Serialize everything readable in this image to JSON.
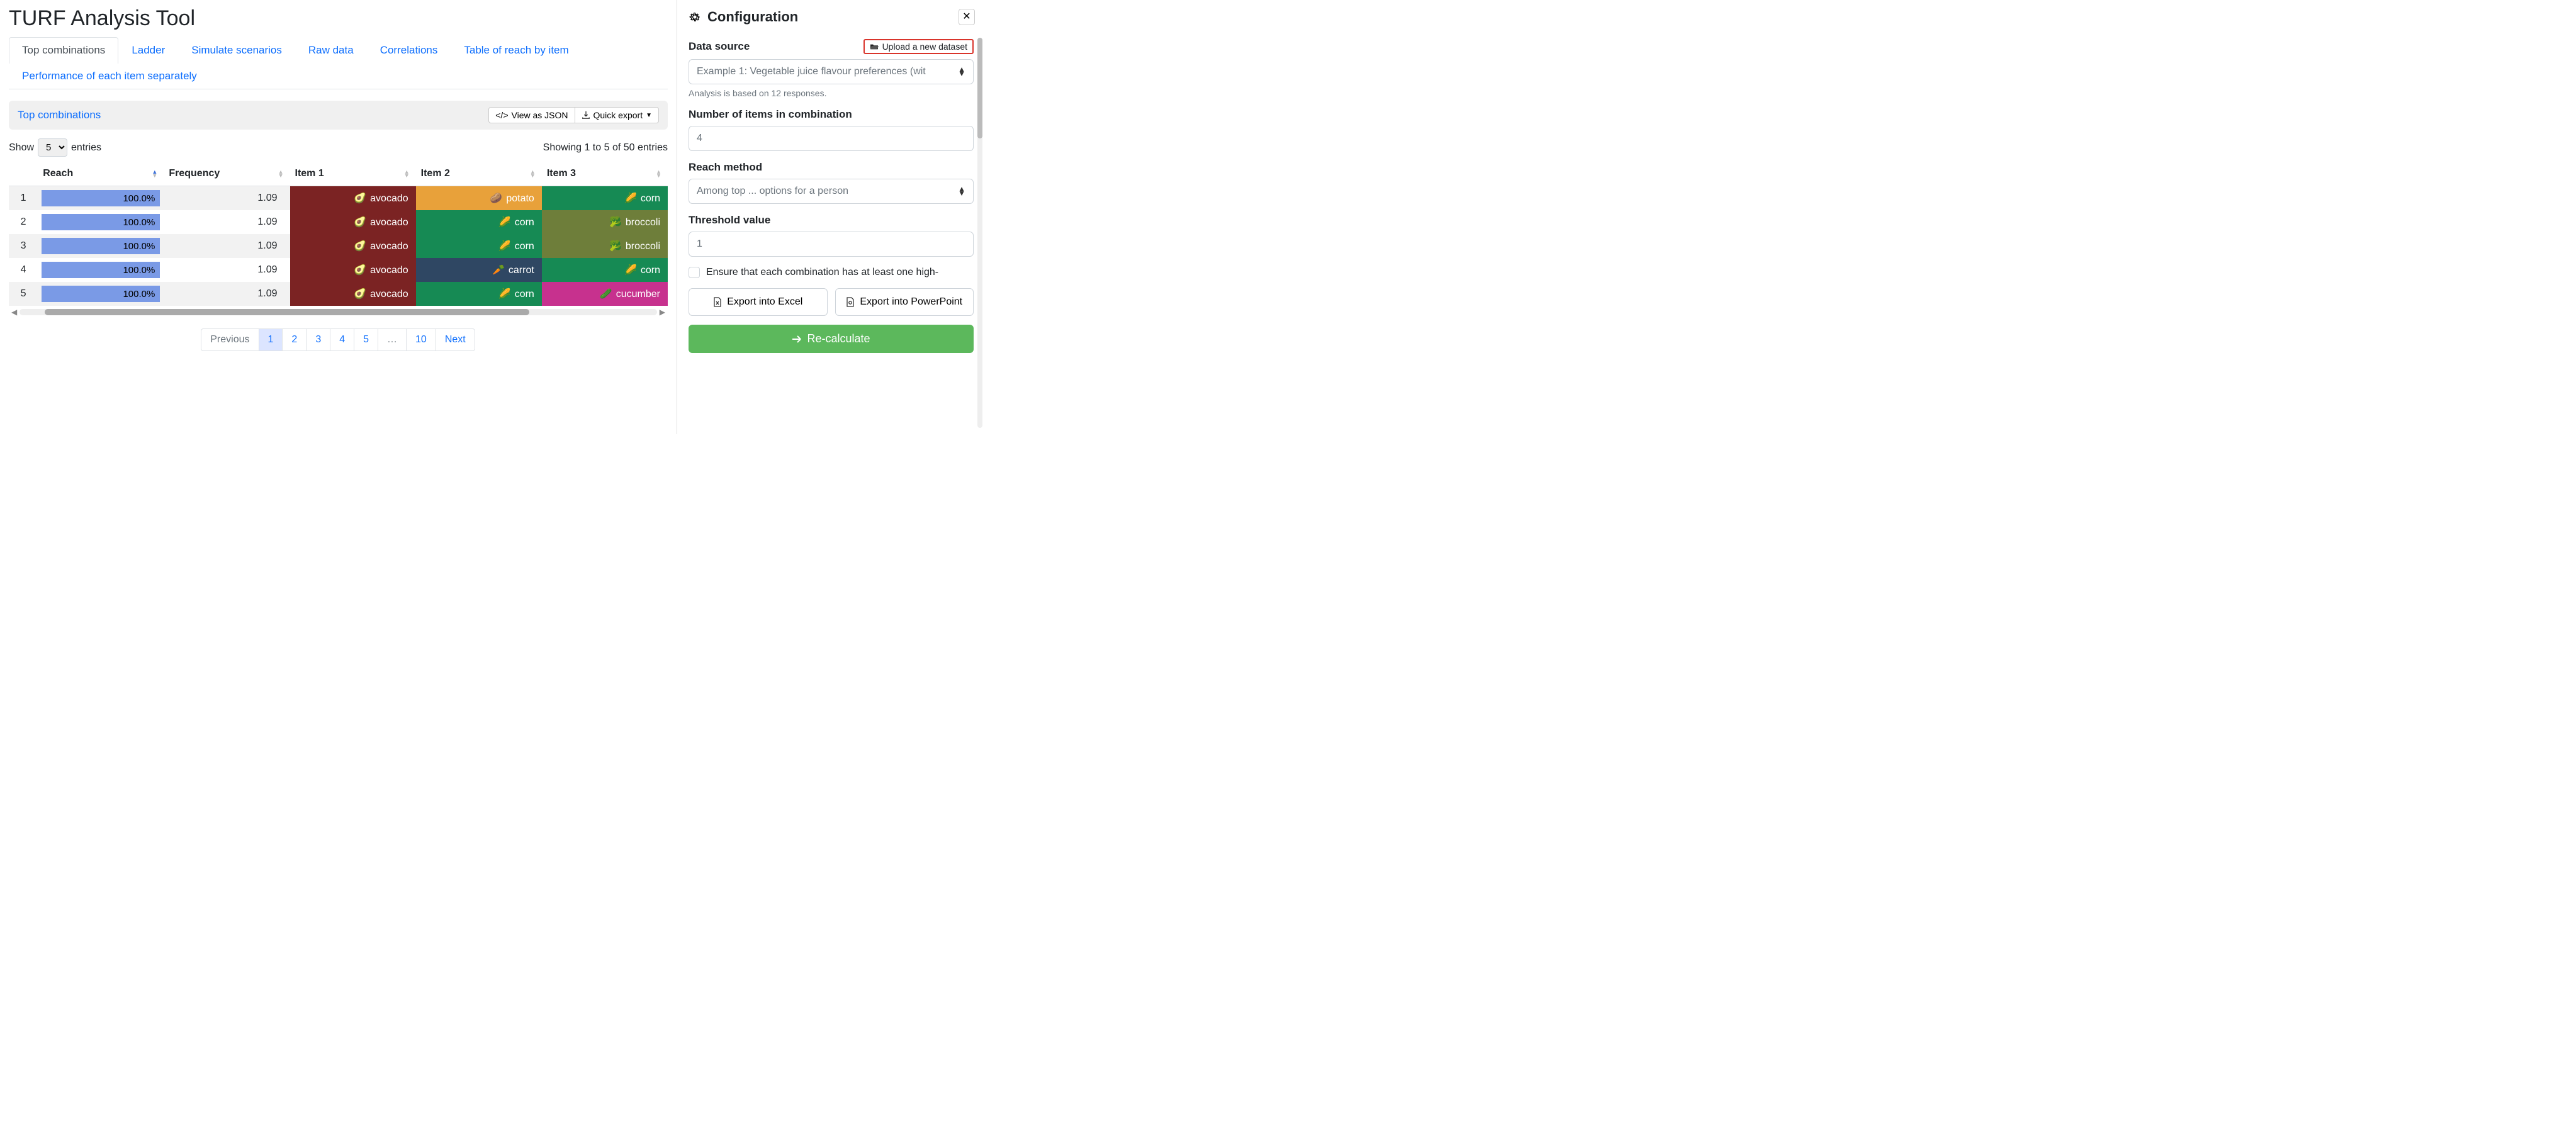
{
  "title": "TURF Analysis Tool",
  "tabs": [
    {
      "label": "Top combinations",
      "active": true
    },
    {
      "label": "Ladder"
    },
    {
      "label": "Simulate scenarios"
    },
    {
      "label": "Raw data"
    },
    {
      "label": "Correlations"
    },
    {
      "label": "Table of reach by item"
    },
    {
      "label": "Performance of each item separately"
    }
  ],
  "subheader": {
    "title": "Top combinations",
    "view_json": "View as JSON",
    "quick_export": "Quick export"
  },
  "table_controls": {
    "show_label": "Show",
    "entries_label": "entries",
    "page_size": "5",
    "showing_text": "Showing 1 to 5 of 50 entries"
  },
  "columns": [
    "Reach",
    "Frequency",
    "Item 1",
    "Item 2",
    "Item 3"
  ],
  "item_emoji": {
    "avocado": "🥑",
    "potato": "🥔",
    "corn": "🌽",
    "broccoli": "🥦",
    "carrot": "🥕",
    "cucumber": "🥒"
  },
  "rows": [
    {
      "idx": "1",
      "reach": "100.0%",
      "freq": "1.09",
      "items": [
        "avocado",
        "potato",
        "corn"
      ]
    },
    {
      "idx": "2",
      "reach": "100.0%",
      "freq": "1.09",
      "items": [
        "avocado",
        "corn",
        "broccoli"
      ]
    },
    {
      "idx": "3",
      "reach": "100.0%",
      "freq": "1.09",
      "items": [
        "avocado",
        "corn",
        "broccoli"
      ]
    },
    {
      "idx": "4",
      "reach": "100.0%",
      "freq": "1.09",
      "items": [
        "avocado",
        "carrot",
        "corn"
      ]
    },
    {
      "idx": "5",
      "reach": "100.0%",
      "freq": "1.09",
      "items": [
        "avocado",
        "corn",
        "cucumber"
      ]
    }
  ],
  "pagination": {
    "prev": "Previous",
    "next": "Next",
    "pages": [
      "1",
      "2",
      "3",
      "4",
      "5",
      "…",
      "10"
    ],
    "active": "1"
  },
  "sidebar": {
    "title": "Configuration",
    "data_source": {
      "label": "Data source",
      "upload": "Upload a new dataset",
      "selected": "Example 1: Vegetable juice flavour preferences (wit",
      "hint": "Analysis is based on 12 responses."
    },
    "num_items": {
      "label": "Number of items in combination",
      "value": "4"
    },
    "reach_method": {
      "label": "Reach method",
      "selected": "Among top ... options for a person"
    },
    "threshold": {
      "label": "Threshold value",
      "value": "1"
    },
    "checkbox": "Ensure that each combination has at least one high-",
    "export_excel": "Export into Excel",
    "export_ppt": "Export into PowerPoint",
    "recalculate": "Re-calculate"
  }
}
